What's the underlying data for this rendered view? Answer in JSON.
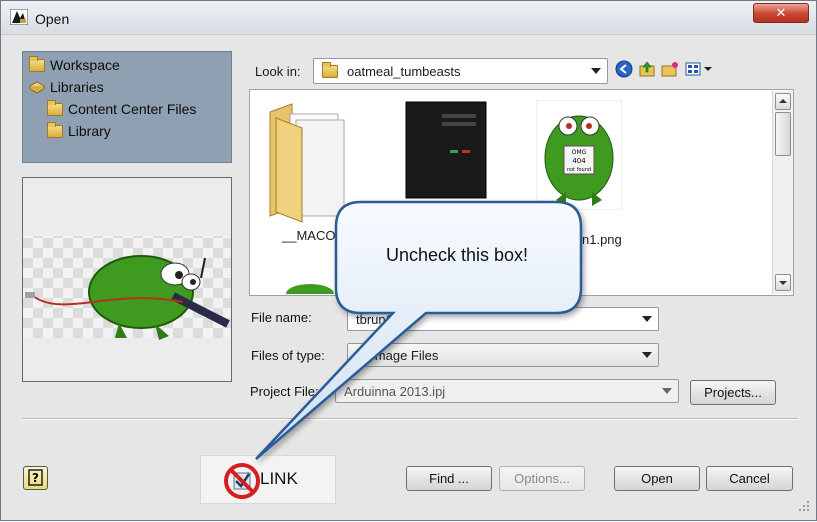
{
  "window": {
    "title": "Open",
    "close_glyph": "✕"
  },
  "places": {
    "items": [
      {
        "label": "Workspace",
        "icon": "folder-icon"
      },
      {
        "label": "Libraries",
        "icon": "libraries-icon"
      },
      {
        "label": "Content Center Files",
        "icon": "folder-icon"
      },
      {
        "label": "Library",
        "icon": "folder-icon"
      }
    ]
  },
  "lookin": {
    "label": "Look in:",
    "value": "oatmeal_tumbeasts",
    "toolbar_icons": [
      "back-icon",
      "up-folder-icon",
      "new-folder-icon",
      "view-menu-icon"
    ]
  },
  "files": {
    "items": [
      {
        "label": "__MACO",
        "icon": "folder-icon"
      },
      {
        "label": "",
        "icon": "computer-tower-icon"
      },
      {
        "label": "n1.png",
        "icon": "monster-404-thumbnail",
        "thumb_lines": [
          "OMG",
          "404",
          "not found"
        ]
      }
    ]
  },
  "fields": {
    "file_name": {
      "label": "File name:",
      "value": "tbrun1"
    },
    "files_of_type": {
      "label": "Files of type:",
      "value": "Al  Image Files"
    },
    "project_file": {
      "label": "Project File:",
      "value": "Arduinna 2013.ipj"
    }
  },
  "buttons": {
    "projects": "Projects...",
    "find": "Find ...",
    "options": "Options...",
    "open": "Open",
    "cancel": "Cancel",
    "help": "?"
  },
  "link_option": {
    "label": "LINK",
    "checked": true
  },
  "callout": {
    "text": "Uncheck this box!"
  },
  "colors": {
    "places_bg": "#8ea0b2",
    "callout_fill": "#dfe9f4",
    "callout_border": "#2c5c98",
    "no_sign": "#d31f1f",
    "monster_green": "#3f9b1f"
  }
}
